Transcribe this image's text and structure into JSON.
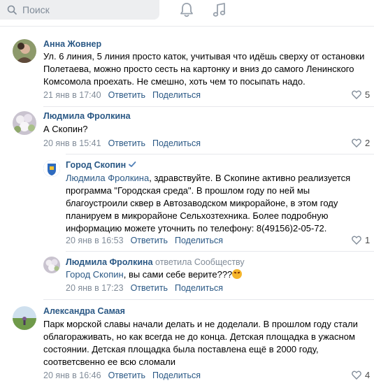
{
  "search": {
    "placeholder": "Поиск"
  },
  "header": {
    "bell_icon": "bell-icon",
    "music_icon": "music-icon"
  },
  "comments": [
    {
      "author": "Анна Жовнер",
      "lines": [
        "Ул. 6 линия, 5 линия просто каток, учитывая что идёшь сверху от остановки",
        "Полетаева, можно просто сесть на картонку и вниз до самого Ленинского",
        "Комсомола проехать. Не смешно, хоть чем то посыпать надо."
      ],
      "date": "21 янв в 17:40",
      "reply": "Ответить",
      "share": "Поделиться",
      "likes": "5"
    },
    {
      "author": "Людмила Фролкина",
      "lines": [
        "А Скопин?"
      ],
      "date": "20 янв в 15:41",
      "reply": "Ответить",
      "share": "Поделиться",
      "likes": "2"
    },
    {
      "author": "Город Скопин",
      "mention": "Людмила Фролкина",
      "lines": [
        ", здравствуйте. В Скопине активно реализуется",
        "программа \"Городская среда\". В прошлом году по ней мы",
        "благоустроили сквер в Автозаводском микрорайоне, в этом году",
        "планируем в микрорайоне Сельхозтехника. Более подробную",
        "информацию можете уточнить по телефону: 8(49156)2-05-72."
      ],
      "date": "20 янв в 16:53",
      "reply": "Ответить",
      "share": "Поделиться",
      "likes": "1"
    },
    {
      "author": "Людмила Фролкина",
      "replied_to": "ответила Сообществу",
      "mention": "Город Скопин",
      "text": ", вы сами себе верите???",
      "date": "20 янв в 17:23",
      "reply": "Ответить",
      "share": "Поделиться"
    },
    {
      "author": "Александра Самая",
      "lines": [
        "Парк морской славы начали делать и не доделали. В прошлом году стали",
        "облагораживать, но как всегда не до конца. Детская площадка в ужасном",
        "состоянии. Детская площадка была поставлена ещё в 2000 году,",
        "соответсвенно ее всю сломали"
      ],
      "date": "20 янв в 16:46",
      "reply": "Ответить",
      "share": "Поделиться",
      "likes": "4"
    }
  ],
  "colors": {
    "link": "#2a5885",
    "muted": "#818c99",
    "divider": "#e7e8ec",
    "search_bg": "#edeef0"
  }
}
